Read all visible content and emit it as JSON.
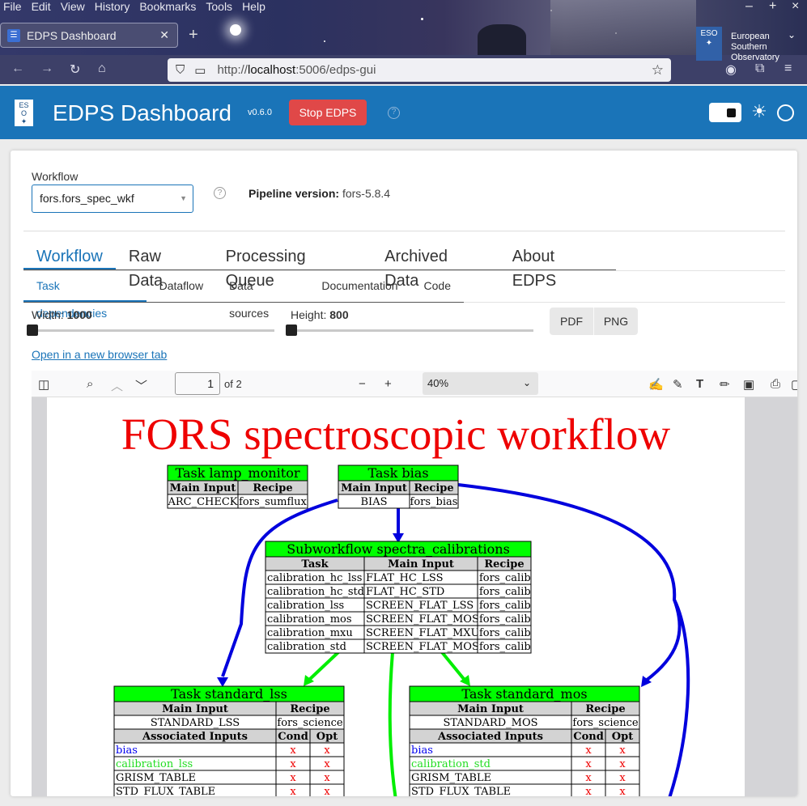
{
  "browser": {
    "menu": [
      "File",
      "Edit",
      "View",
      "History",
      "Bookmarks",
      "Tools",
      "Help"
    ],
    "tab_title": "EDPS Dashboard",
    "url_prefix": "http://",
    "url_host": "localhost",
    "url_rest": ":5006/edps-gui",
    "eso_logo_text": "ESO",
    "eso_text": [
      "European",
      "Southern",
      "Observatory"
    ]
  },
  "header": {
    "title": "EDPS Dashboard",
    "version": "v0.6.0",
    "stop_label": "Stop EDPS"
  },
  "controls": {
    "workflow_label": "Workflow",
    "workflow_value": "fors.fors_spec_wkf",
    "pipeline_label": "Pipeline version:",
    "pipeline_value": "fors-5.8.4"
  },
  "main_tabs": [
    "Workflow",
    "Raw Data",
    "Processing Queue",
    "Archived Data",
    "About EDPS"
  ],
  "sub_tabs": [
    "Task dependencies",
    "Dataflow",
    "Data sources",
    "Documentation",
    "Code"
  ],
  "sliders": {
    "width_label": "Width:",
    "width_value": "1000",
    "height_label": "Height:",
    "height_value": "800"
  },
  "export_buttons": [
    "PDF",
    "PNG"
  ],
  "open_link": "Open in a new browser tab",
  "pdf_viewer": {
    "page": "1",
    "of_pages": "of 2",
    "zoom": "40%"
  },
  "graph": {
    "title": "FORS spectroscopic workflow",
    "lamp_monitor": {
      "header": "Task lamp_monitor",
      "cols": [
        "Main Input",
        "Recipe"
      ],
      "row": [
        "ARC_CHECK",
        "fors_sumflux"
      ]
    },
    "bias": {
      "header": "Task bias",
      "cols": [
        "Main Input",
        "Recipe"
      ],
      "row": [
        "BIAS",
        "fors_bias"
      ]
    },
    "calibrations": {
      "header": "Subworkflow spectra_calibrations",
      "cols": [
        "Task",
        "Main Input",
        "Recipe"
      ],
      "rows": [
        [
          "calibration_hc_lss",
          "FLAT_HC_LSS",
          "fors_calib"
        ],
        [
          "calibration_hc_std",
          "FLAT_HC_STD",
          "fors_calib"
        ],
        [
          "calibration_lss",
          "SCREEN_FLAT_LSS",
          "fors_calib"
        ],
        [
          "calibration_mos",
          "SCREEN_FLAT_MOS",
          "fors_calib"
        ],
        [
          "calibration_mxu",
          "SCREEN_FLAT_MXU",
          "fors_calib"
        ],
        [
          "calibration_std",
          "SCREEN_FLAT_MOS",
          "fors_calib"
        ]
      ]
    },
    "standard_lss": {
      "header": "Task standard_lss",
      "cols": [
        "Main Input",
        "Recipe"
      ],
      "row": [
        "STANDARD_LSS",
        "fors_science"
      ],
      "assoc_cols": [
        "Associated Inputs",
        "Cond",
        "Opt"
      ],
      "assoc": [
        {
          "name": "bias",
          "color": "#0000ee",
          "cond": "x",
          "opt": "x"
        },
        {
          "name": "calibration_lss",
          "color": "#22dd22",
          "cond": "x",
          "opt": "x"
        },
        {
          "name": "GRISM_TABLE",
          "color": "#000000",
          "cond": "x",
          "opt": "x"
        },
        {
          "name": "STD_FLUX_TABLE",
          "color": "#000000",
          "cond": "x",
          "opt": "x"
        }
      ]
    },
    "standard_mos": {
      "header": "Task standard_mos",
      "cols": [
        "Main Input",
        "Recipe"
      ],
      "row": [
        "STANDARD_MOS",
        "fors_science"
      ],
      "assoc_cols": [
        "Associated Inputs",
        "Cond",
        "Opt"
      ],
      "assoc": [
        {
          "name": "bias",
          "color": "#0000ee",
          "cond": "x",
          "opt": "x"
        },
        {
          "name": "calibration_std",
          "color": "#22dd22",
          "cond": "x",
          "opt": "x"
        },
        {
          "name": "GRISM_TABLE",
          "color": "#000000",
          "cond": "x",
          "opt": "x"
        },
        {
          "name": "STD_FLUX_TABLE",
          "color": "#000000",
          "cond": "x",
          "opt": "x"
        }
      ]
    },
    "colors": {
      "title": "#ee0000",
      "node_header": "#00ff00",
      "col_header": "#d3d3d3",
      "edge_bias": "#0000dd",
      "edge_calib": "#00ee00",
      "mark": "#ee0000"
    }
  }
}
